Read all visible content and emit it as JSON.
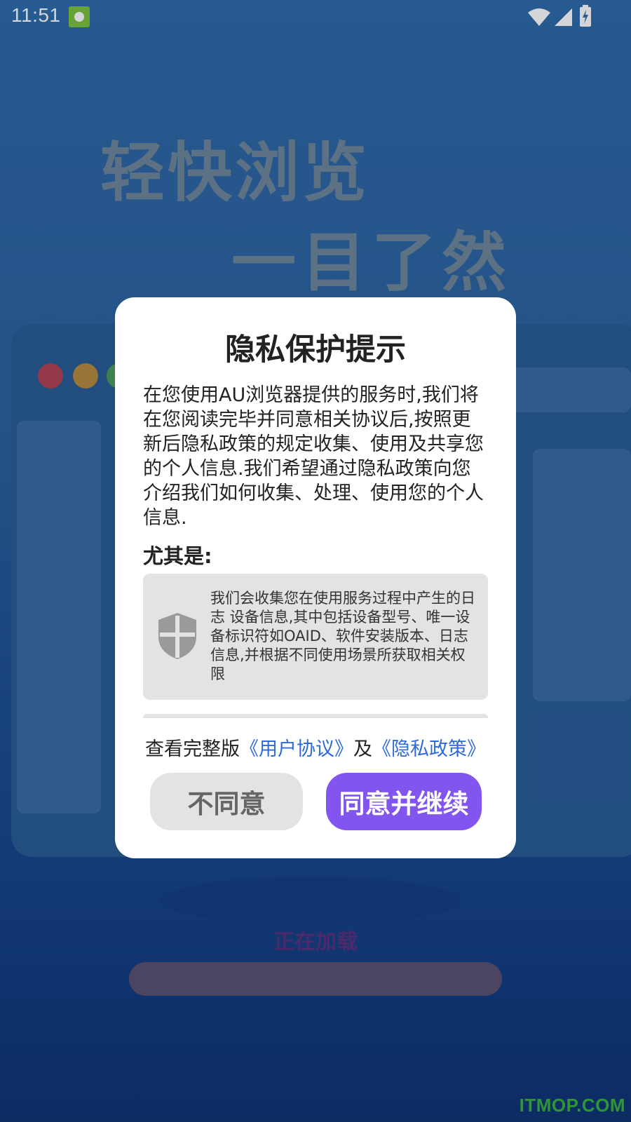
{
  "status_bar": {
    "time": "11:51",
    "icons": [
      "app-notification-icon",
      "wifi-icon",
      "cell-signal-icon",
      "battery-charging-icon"
    ]
  },
  "background": {
    "headline_line1": "轻快浏览",
    "headline_line2": "一目了然",
    "loading_text": "正在加载",
    "watermark": "ITMOP.COM"
  },
  "dialog": {
    "title": "隐私保护提示",
    "body": "在您使用AU浏览器提供的服务时,我们将在您阅读完毕并同意相关协议后,按照更新后隐私政策的规定收集、使用及共享您的个人信息.我们希望通过隐私政策向您介绍我们如何收集、处理、使用您的个人信息.",
    "subtitle": "尤其是:",
    "info_card": {
      "icon": "shield-icon",
      "text": "我们会收集您在使用服务过程中产生的日志 设备信息,其中包括设备型号、唯一设备标识符如OAID、软件安装版本、日志信息,并根据不同使用场景所获取相关权限"
    },
    "links": {
      "prefix": "查看完整版",
      "user_agreement": "《用户协议》",
      "connector": "及",
      "privacy_policy": "《隐私政策》"
    },
    "buttons": {
      "disagree": "不同意",
      "agree": "同意并继续"
    }
  },
  "colors": {
    "accent": "#8155ee",
    "link": "#2f6bd8",
    "dialog_bg": "#ffffff",
    "secondary_button_bg": "#e3e3e3"
  }
}
